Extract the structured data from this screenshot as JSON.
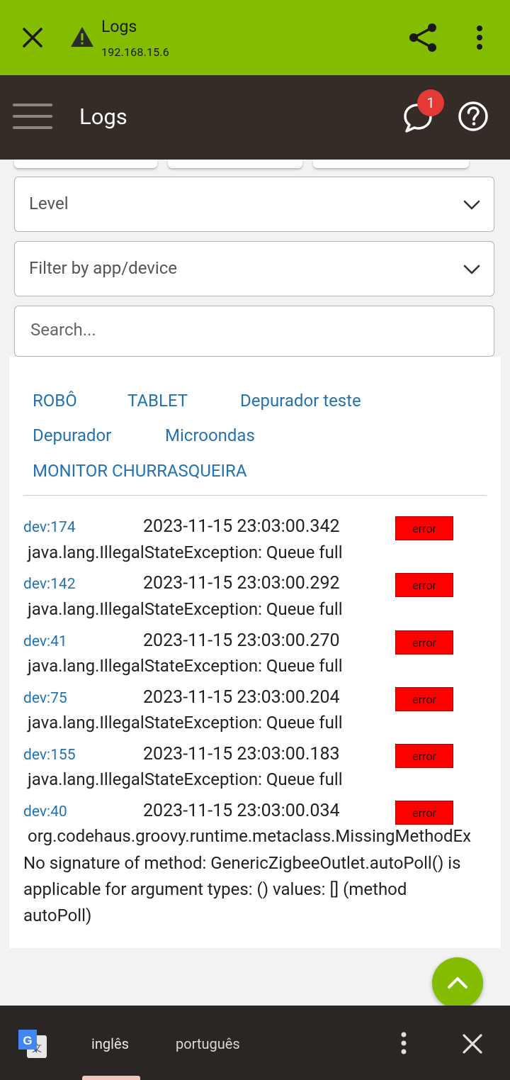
{
  "browser": {
    "title": "Logs",
    "url": "192.168.15.6",
    "icons": [
      "close-icon",
      "warning-icon",
      "share-icon",
      "more-vert-icon"
    ]
  },
  "header": {
    "title": "Logs",
    "notification_count": "1",
    "icons": [
      "menu-icon",
      "chat-icon",
      "help-icon"
    ]
  },
  "filters": {
    "level_label": "Level",
    "app_filter_label": "Filter by app/device",
    "search_placeholder": "Search..."
  },
  "quick_filters": [
    "ROBÔ",
    "TABLET",
    "Depurador teste",
    "Depurador",
    "Microondas",
    "MONITOR CHURRASQUEIRA"
  ],
  "logs": [
    {
      "device": "dev:174",
      "time": "2023-11-15 23:03:00.342",
      "level": "error",
      "message": "java.lang.IllegalStateException: Queue full"
    },
    {
      "device": "dev:142",
      "time": "2023-11-15 23:03:00.292",
      "level": "error",
      "message": "java.lang.IllegalStateException: Queue full"
    },
    {
      "device": "dev:41",
      "time": "2023-11-15 23:03:00.270",
      "level": "error",
      "message": "java.lang.IllegalStateException: Queue full"
    },
    {
      "device": "dev:75",
      "time": "2023-11-15 23:03:00.204",
      "level": "error",
      "message": "java.lang.IllegalStateException: Queue full"
    },
    {
      "device": "dev:155",
      "time": "2023-11-15 23:03:00.183",
      "level": "error",
      "message": "java.lang.IllegalStateException: Queue full"
    },
    {
      "device": "dev:40",
      "time": "2023-11-15 23:03:00.034",
      "level": "error",
      "message": "org.codehaus.groovy.runtime.metaclass.MissingMethodEx",
      "detail": "No signature of method: GenericZigbeeOutlet.autoPoll() is applicable for argument types: () values: [] (method autoPoll)"
    }
  ],
  "translate": {
    "source_lang": "inglês",
    "target_lang": "português",
    "icons": [
      "google-translate-icon",
      "more-vert-icon",
      "close-icon"
    ]
  },
  "colors": {
    "browser_bar": "#84bc00",
    "app_header": "#352c28",
    "link": "#2472b2",
    "error_badge": "#ff0000",
    "notification_badge": "#e53935"
  }
}
